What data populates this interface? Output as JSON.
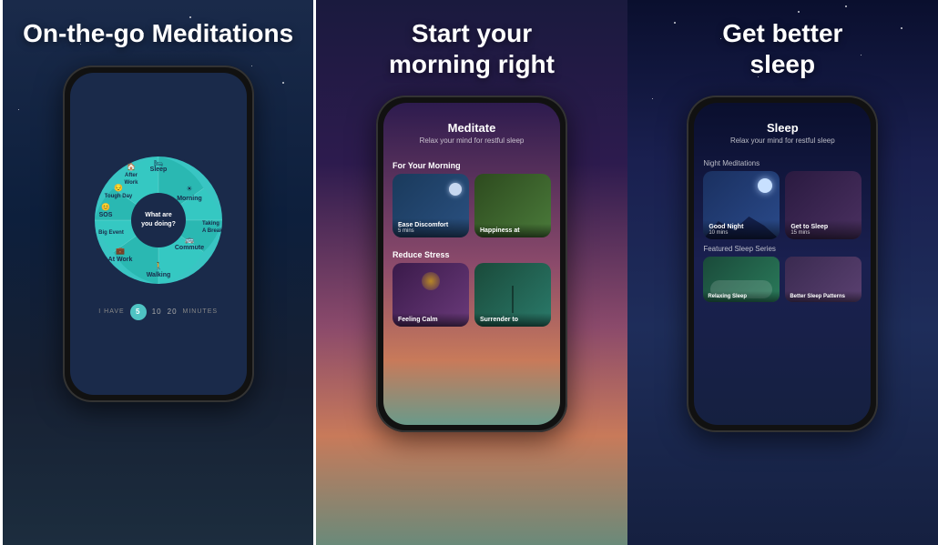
{
  "panels": [
    {
      "id": "panel-1",
      "title": "On-the-go\nMeditations",
      "wheel": {
        "center_text": "What are\nyou doing?",
        "items": [
          {
            "label": "Sleep",
            "angle": 315
          },
          {
            "label": "Morning",
            "angle": 0
          },
          {
            "label": "Taking\nA Break",
            "angle": 45
          },
          {
            "label": "Commute",
            "angle": 90
          },
          {
            "label": "Walking",
            "angle": 135
          },
          {
            "label": "At Work",
            "angle": 180
          },
          {
            "label": "Big Event",
            "angle": 205
          },
          {
            "label": "SOS",
            "angle": 230
          },
          {
            "label": "Tough Day",
            "angle": 270
          },
          {
            "label": "After\nWork",
            "angle": 295
          }
        ]
      },
      "time_bar": {
        "prefix": "I HAVE",
        "times": [
          "5",
          "10",
          "20"
        ],
        "suffix": "MINUTES"
      }
    },
    {
      "id": "panel-2",
      "title": "Start your\nmorning right",
      "screen": {
        "title": "Meditate",
        "subtitle": "Relax your mind for restful sleep",
        "sections": [
          {
            "label": "For Your Morning",
            "cards": [
              {
                "title": "Ease Discomfort",
                "duration": "5 mins",
                "bg": 1
              },
              {
                "title": "Happiness at",
                "duration": "",
                "bg": 2
              }
            ]
          },
          {
            "label": "Reduce Stress",
            "cards": [
              {
                "title": "Feeling Calm",
                "duration": "",
                "bg": 3
              },
              {
                "title": "Surrender to",
                "duration": "",
                "bg": 4
              }
            ]
          }
        ]
      }
    },
    {
      "id": "panel-3",
      "title": "Get better\nsleep",
      "screen": {
        "title": "Sleep",
        "subtitle": "Relax your mind for restful sleep",
        "night_meditations_label": "Night Meditations",
        "night_cards": [
          {
            "title": "Good Night",
            "duration": "10 mins"
          },
          {
            "title": "Get to Sleep",
            "duration": "15 mins"
          }
        ],
        "featured_label": "Featured Sleep Series",
        "featured_cards": [
          {
            "title": "Relaxing Sleep",
            "duration": ""
          },
          {
            "title": "Better Sleep\nPatterns",
            "duration": ""
          }
        ]
      }
    }
  ]
}
